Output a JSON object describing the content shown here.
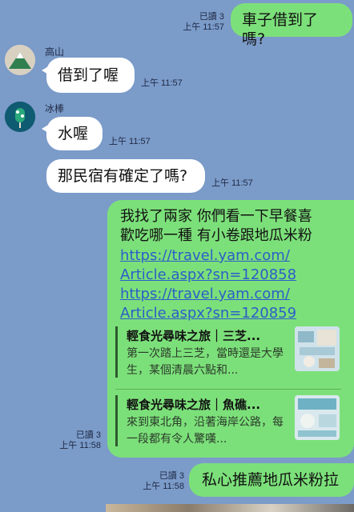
{
  "messages": [
    {
      "id": "m1",
      "side": "me",
      "text": "車子借到了嗎?",
      "read": "已讀 3",
      "time": "上午 11:57"
    },
    {
      "id": "m2",
      "side": "them",
      "sender": "高山",
      "text": "借到了喔",
      "time": "上午 11:57"
    },
    {
      "id": "m3",
      "side": "them",
      "sender": "冰棒",
      "text": "水喔",
      "time": "上午 11:57"
    },
    {
      "id": "m4",
      "side": "them",
      "text": "那民宿有確定了嗎?",
      "time": "上午 11:57"
    },
    {
      "id": "m5",
      "side": "me",
      "text_line1": "我找了兩家 你們看一下早餐喜",
      "text_line2": "歡吃哪一種 有小卷跟地瓜米粉",
      "link1_line1": "https://travel.yam.com/",
      "link1_line2": "Article.aspx?sn=120858",
      "link2_line1": "https://travel.yam.com/",
      "link2_line2": "Article.aspx?sn=120859",
      "previews": [
        {
          "title": "輕食光尋味之旅｜三芝...",
          "desc": "第一次踏上三芝，當時還是大學生，某個清晨六點和..."
        },
        {
          "title": "輕食光尋味之旅｜魚礁...",
          "desc": "來到東北角，沿著海岸公路，每一段都有令人驚嘆..."
        }
      ],
      "read": "已讀 3",
      "time": "上午 11:58"
    },
    {
      "id": "m6",
      "side": "me",
      "text": "私心推薦地瓜米粉拉",
      "read": "已讀 3",
      "time": "上午 11:58"
    }
  ],
  "colors": {
    "background": "#7B9BC9",
    "my_bubble": "#7CE07A",
    "their_bubble": "#FFFFFF",
    "link": "#2C5DC9"
  },
  "icons": {
    "avatar1": "mountain-avatar-icon",
    "avatar2": "popsicle-avatar-icon"
  }
}
